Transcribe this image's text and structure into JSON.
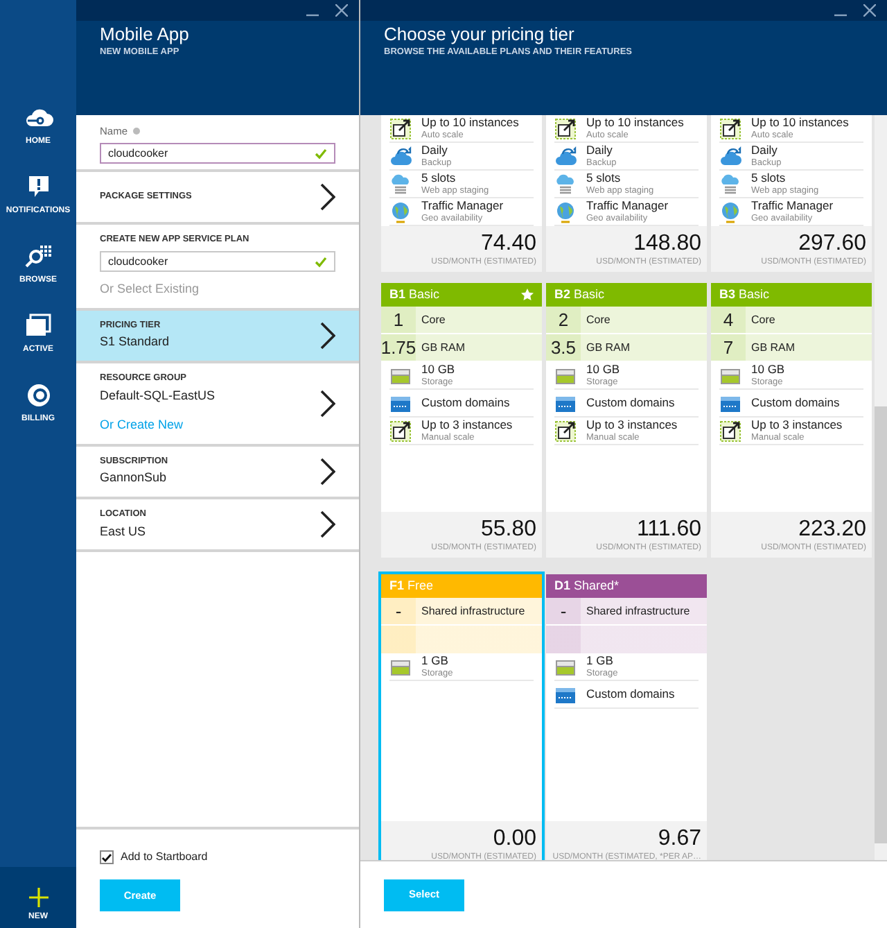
{
  "nav": {
    "items": [
      {
        "label": "HOME",
        "kind": "home"
      },
      {
        "label": "NOTIFICATIONS",
        "kind": "notifications"
      },
      {
        "label": "BROWSE",
        "kind": "browse"
      },
      {
        "label": "ACTIVE",
        "kind": "active"
      },
      {
        "label": "BILLING",
        "kind": "billing"
      }
    ],
    "new_button": {
      "label": "NEW"
    }
  },
  "create_blade": {
    "title": "Mobile App",
    "subtitle": "NEW MOBILE APP",
    "sections": [
      {
        "kind": "field",
        "label": "Name",
        "info": true,
        "value": "cloudcooker",
        "valid": true,
        "focused": true
      },
      {
        "kind": "nav",
        "label": "PACKAGE SETTINGS",
        "selected": false
      },
      {
        "kind": "field",
        "label": "CREATE NEW APP SERVICE PLAN",
        "info": false,
        "value": "cloudcooker",
        "valid": true,
        "focused": false,
        "link": {
          "text": "Or Select Existing",
          "disabled": true
        }
      },
      {
        "kind": "nav",
        "label": "PRICING TIER",
        "value": "S1 Standard",
        "selected": true
      },
      {
        "kind": "nav",
        "label": "RESOURCE GROUP",
        "value": "Default-SQL-EastUS",
        "selected": false,
        "link": {
          "text": "Or Create New",
          "disabled": false
        }
      },
      {
        "kind": "nav",
        "label": "SUBSCRIPTION",
        "value": "GannonSub",
        "selected": false
      },
      {
        "kind": "nav",
        "label": "LOCATION",
        "value": "East US",
        "selected": false
      }
    ],
    "startboard": {
      "label": "Add to Startboard",
      "checked": true
    },
    "button": "Create"
  },
  "pricing_blade": {
    "title": "Choose your pricing tier",
    "subtitle": "BROWSE THE AVAILABLE PLANS AND THEIR FEATURES",
    "rows": [
      [
        {
          "selected": false,
          "features": [
            {
              "kind": "scale",
              "title": "Up to 10 instances",
              "subtitle": "Auto scale"
            },
            {
              "kind": "backup",
              "title": "Daily",
              "subtitle": "Backup"
            },
            {
              "kind": "staging",
              "title": "5 slots",
              "subtitle": "Web app staging"
            },
            {
              "kind": "traffic",
              "title": "Traffic Manager",
              "subtitle": "Geo availability"
            }
          ],
          "price": "74.40",
          "price_note": "USD/MONTH (ESTIMATED)"
        },
        {
          "selected": false,
          "features": [
            {
              "kind": "scale",
              "title": "Up to 10 instances",
              "subtitle": "Auto scale"
            },
            {
              "kind": "backup",
              "title": "Daily",
              "subtitle": "Backup"
            },
            {
              "kind": "staging",
              "title": "5 slots",
              "subtitle": "Web app staging"
            },
            {
              "kind": "traffic",
              "title": "Traffic Manager",
              "subtitle": "Geo availability"
            }
          ],
          "price": "148.80",
          "price_note": "USD/MONTH (ESTIMATED)"
        },
        {
          "selected": false,
          "features": [
            {
              "kind": "scale",
              "title": "Up to 10 instances",
              "subtitle": "Auto scale"
            },
            {
              "kind": "backup",
              "title": "Daily",
              "subtitle": "Backup"
            },
            {
              "kind": "staging",
              "title": "5 slots",
              "subtitle": "Web app staging"
            },
            {
              "kind": "traffic",
              "title": "Traffic Manager",
              "subtitle": "Geo availability"
            }
          ],
          "price": "297.60",
          "price_note": "USD/MONTH (ESTIMATED)"
        }
      ],
      [
        {
          "code": "B1",
          "name": "Basic",
          "color": "#7fba00",
          "recommended": true,
          "selected": false,
          "specs": [
            {
              "value": "1",
              "label": "Core"
            },
            {
              "value": "1.75",
              "label": "GB RAM"
            }
          ],
          "features": [
            {
              "kind": "storage",
              "title": "10 GB",
              "subtitle": "Storage"
            },
            {
              "kind": "domains",
              "title": "Custom domains"
            },
            {
              "kind": "scale",
              "title": "Up to 3 instances",
              "subtitle": "Manual scale"
            }
          ],
          "price": "55.80",
          "price_note": "USD/MONTH (ESTIMATED)"
        },
        {
          "code": "B2",
          "name": "Basic",
          "color": "#7fba00",
          "recommended": false,
          "selected": false,
          "specs": [
            {
              "value": "2",
              "label": "Core"
            },
            {
              "value": "3.5",
              "label": "GB RAM"
            }
          ],
          "features": [
            {
              "kind": "storage",
              "title": "10 GB",
              "subtitle": "Storage"
            },
            {
              "kind": "domains",
              "title": "Custom domains"
            },
            {
              "kind": "scale",
              "title": "Up to 3 instances",
              "subtitle": "Manual scale"
            }
          ],
          "price": "111.60",
          "price_note": "USD/MONTH (ESTIMATED)"
        },
        {
          "code": "B3",
          "name": "Basic",
          "color": "#7fba00",
          "recommended": false,
          "selected": false,
          "specs": [
            {
              "value": "4",
              "label": "Core"
            },
            {
              "value": "7",
              "label": "GB RAM"
            }
          ],
          "features": [
            {
              "kind": "storage",
              "title": "10 GB",
              "subtitle": "Storage"
            },
            {
              "kind": "domains",
              "title": "Custom domains"
            },
            {
              "kind": "scale",
              "title": "Up to 3 instances",
              "subtitle": "Manual scale"
            }
          ],
          "price": "223.20",
          "price_note": "USD/MONTH (ESTIMATED)"
        }
      ],
      [
        {
          "code": "F1",
          "name": "Free",
          "color": "#ffb900",
          "recommended": false,
          "selected": true,
          "specs": [
            {
              "value": "-",
              "label": "Shared infrastructure"
            }
          ],
          "features": [
            {
              "kind": "storage",
              "title": "1 GB",
              "subtitle": "Storage"
            }
          ],
          "price": "0.00",
          "price_note": "USD/MONTH (ESTIMATED)"
        },
        {
          "code": "D1",
          "name": "Shared*",
          "color": "#9b4f96",
          "recommended": false,
          "selected": false,
          "specs": [
            {
              "value": "-",
              "label": "Shared infrastructure"
            }
          ],
          "features": [
            {
              "kind": "storage",
              "title": "1 GB",
              "subtitle": "Storage"
            },
            {
              "kind": "domains",
              "title": "Custom domains"
            }
          ],
          "price": "9.67",
          "price_note": "USD/MONTH (ESTIMATED, *PER AP…"
        }
      ]
    ],
    "button": "Select"
  }
}
